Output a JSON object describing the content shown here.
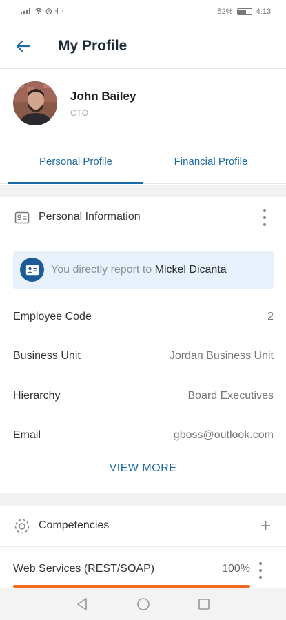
{
  "status_bar": {
    "battery": "52%",
    "time": "4:13"
  },
  "header": {
    "title": "My Profile"
  },
  "profile": {
    "name": "John Bailey",
    "role": "CTO"
  },
  "tabs": [
    {
      "label": "Personal Profile",
      "active": true
    },
    {
      "label": "Financial Profile",
      "active": false
    }
  ],
  "personal_info": {
    "title": "Personal Information",
    "report_prefix": "You directly report to",
    "report_name": "Mickel Dicanta",
    "rows": [
      {
        "label": "Employee Code",
        "value": "2"
      },
      {
        "label": "Business Unit",
        "value": "Jordan Business Unit"
      },
      {
        "label": "Hierarchy",
        "value": "Board Executives"
      },
      {
        "label": "Email",
        "value": "gboss@outlook.com"
      }
    ],
    "view_more": "VIEW MORE"
  },
  "competencies": {
    "title": "Competencies",
    "items": [
      {
        "name": "Web Services (REST/SOAP)",
        "percent_label": "100%",
        "progress": 1.0
      }
    ]
  },
  "colors": {
    "accent": "#1b6aa8",
    "progress": "#f26b21",
    "report_bg": "#e6f1fb"
  }
}
